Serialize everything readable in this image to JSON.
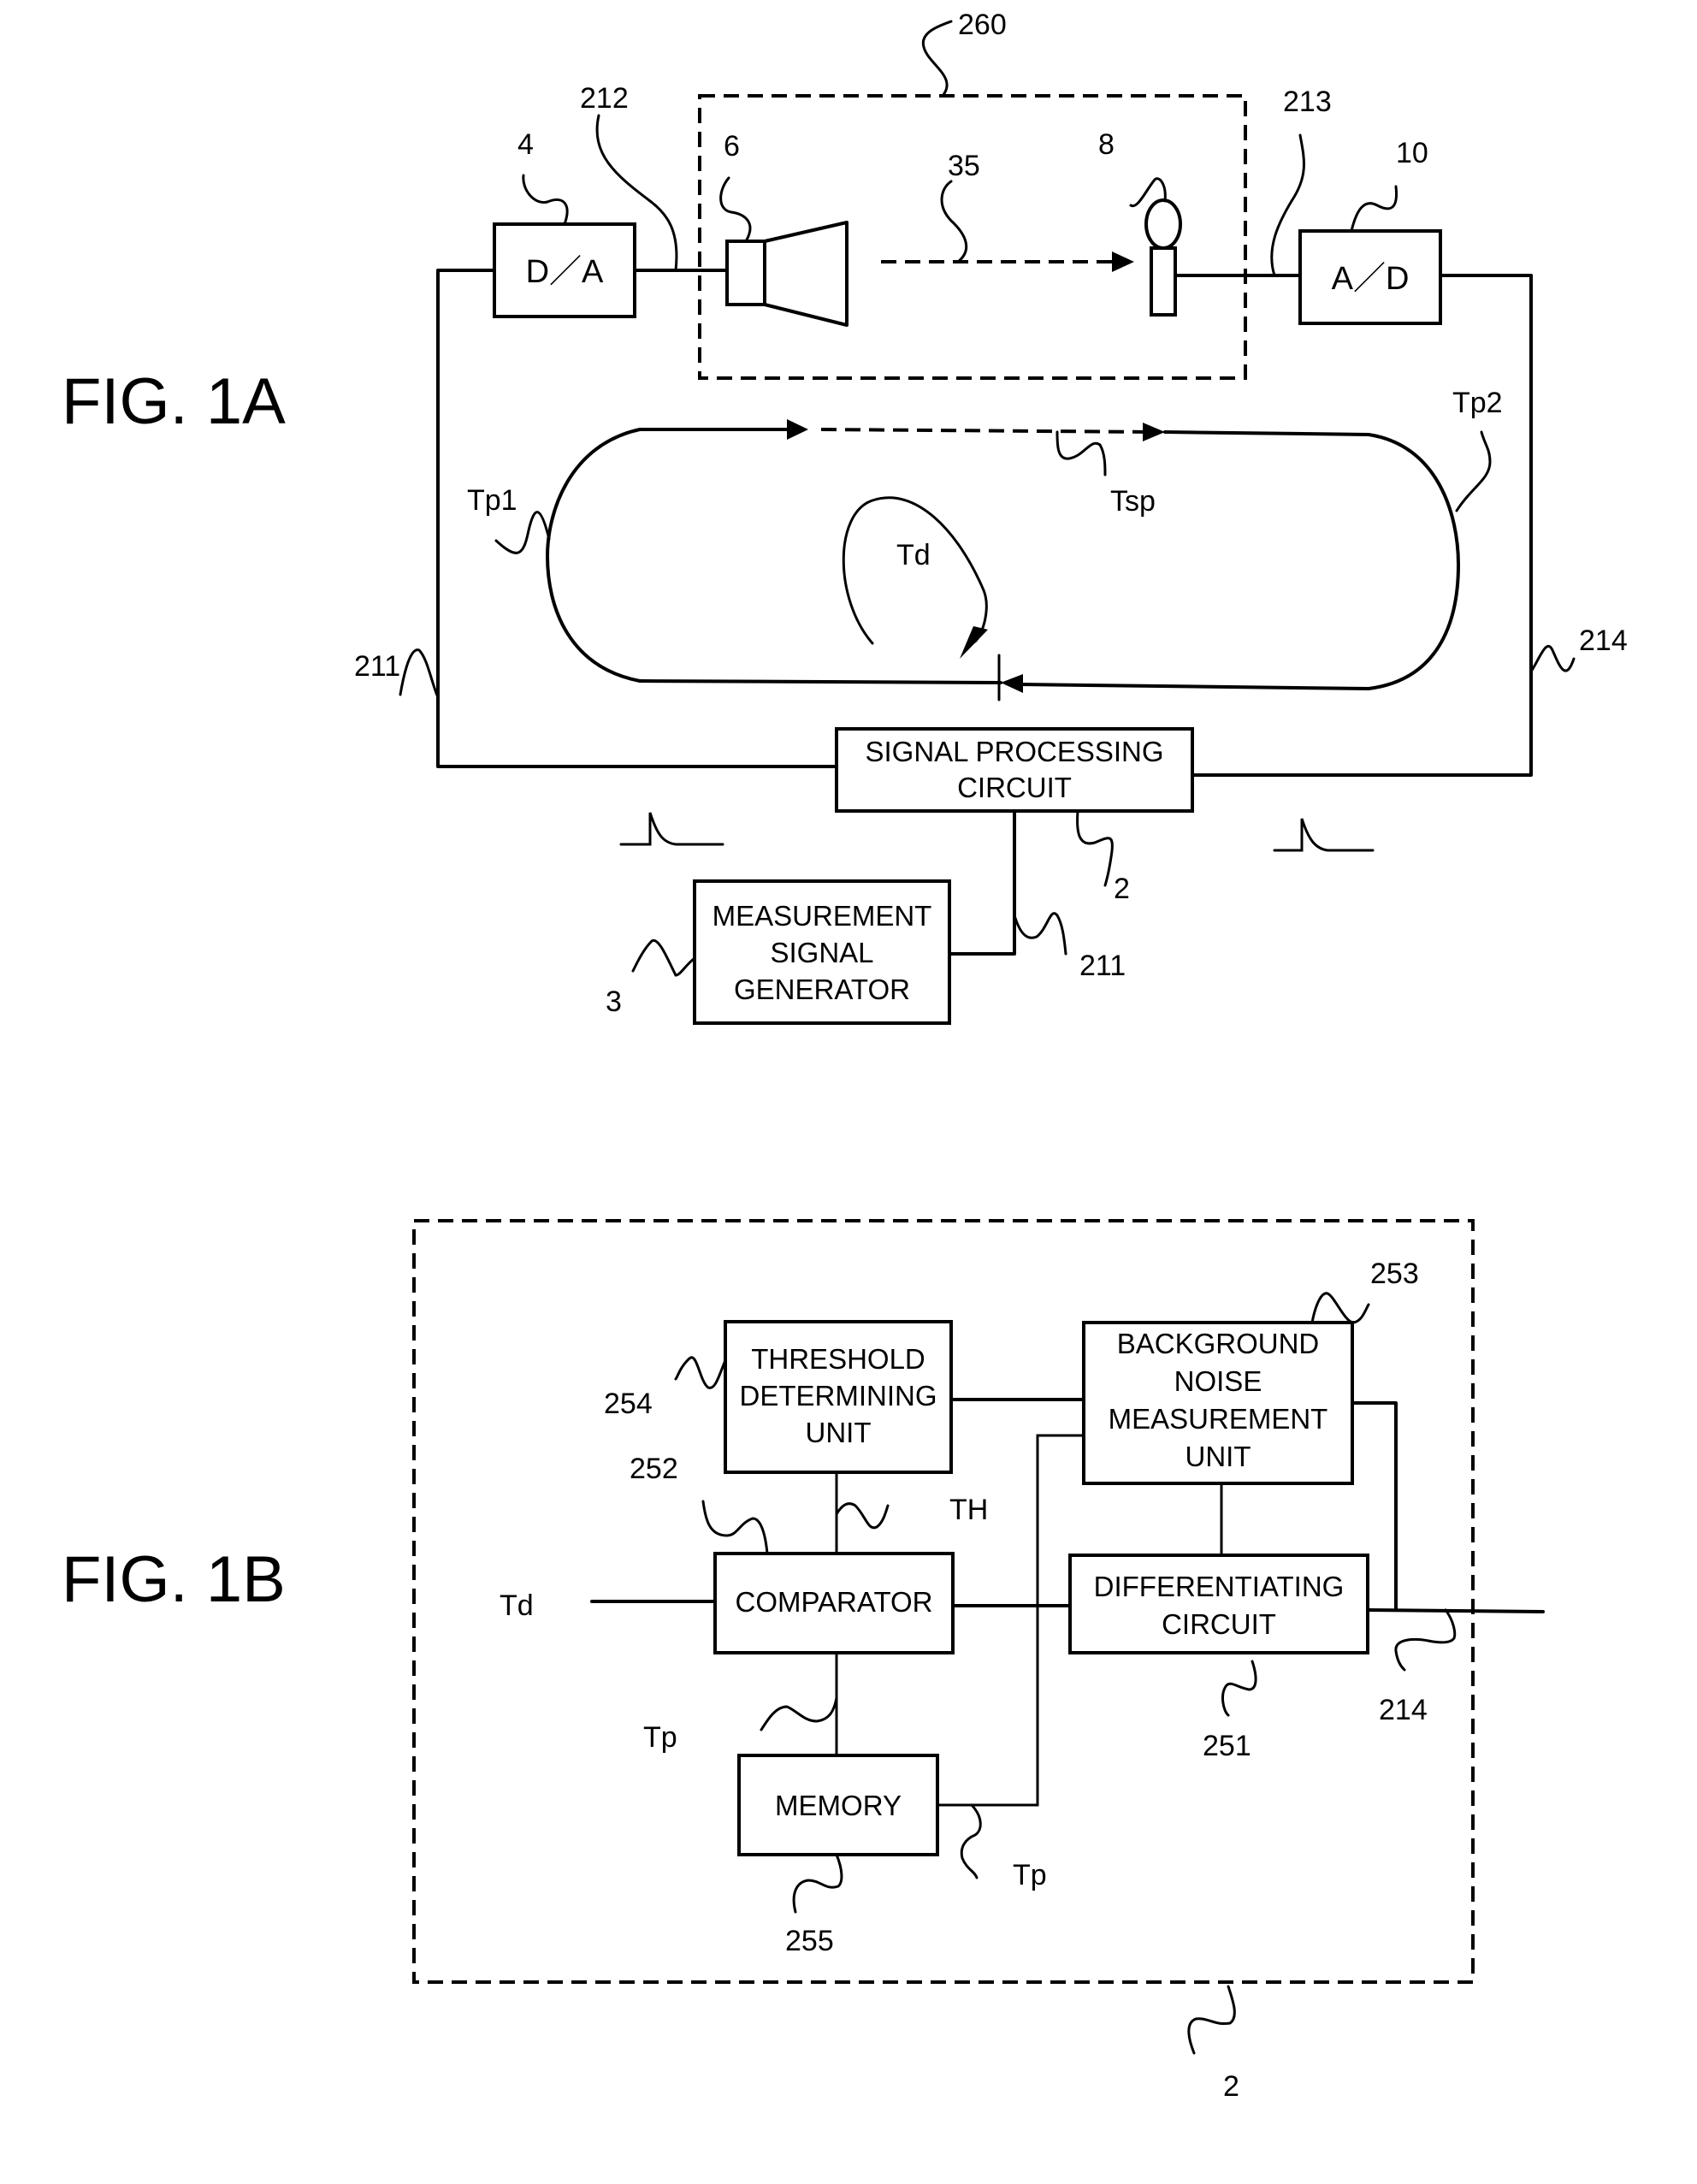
{
  "figures": [
    {
      "id": "1A",
      "label": "FIG. 1A",
      "blocks": {
        "da": "D／A",
        "ad": "A／D",
        "signal_processing": [
          "SIGNAL PROCESSING",
          "CIRCUIT"
        ],
        "measurement_generator": [
          "MEASUREMENT",
          "SIGNAL",
          "GENERATOR"
        ]
      },
      "references": {
        "dashed_enclosure": "260",
        "da_converter": "4",
        "line_212": "212",
        "speaker": "6",
        "sound_path": "35",
        "microphone": "8",
        "line_213": "213",
        "ad_converter": "10",
        "line_211_left": "211",
        "line_214": "214",
        "signal_processing_circuit": "2",
        "line_211_bottom": "211",
        "measurement_signal_generator": "3"
      },
      "timing_labels": {
        "tp1": "Tp1",
        "tp2": "Tp2",
        "tsp": "Tsp",
        "td": "Td"
      }
    },
    {
      "id": "1B",
      "label": "FIG. 1B",
      "blocks": {
        "threshold": [
          "THRESHOLD",
          "DETERMINING",
          "UNIT"
        ],
        "background_noise": [
          "BACKGROUND",
          "NOISE",
          "MEASUREMENT",
          "UNIT"
        ],
        "comparator": "COMPARATOR",
        "differentiating": [
          "DIFFERENTIATING",
          "CIRCUIT"
        ],
        "memory": "MEMORY"
      },
      "references": {
        "background_noise_unit": "253",
        "threshold_unit": "254",
        "comparator": "252",
        "differentiating_circuit": "251",
        "line_214": "214",
        "memory": "255",
        "enclosure": "2"
      },
      "signal_labels": {
        "th": "TH",
        "td_input": "Td",
        "tp_comparator": "Tp",
        "tp_memory": "Tp"
      }
    }
  ]
}
